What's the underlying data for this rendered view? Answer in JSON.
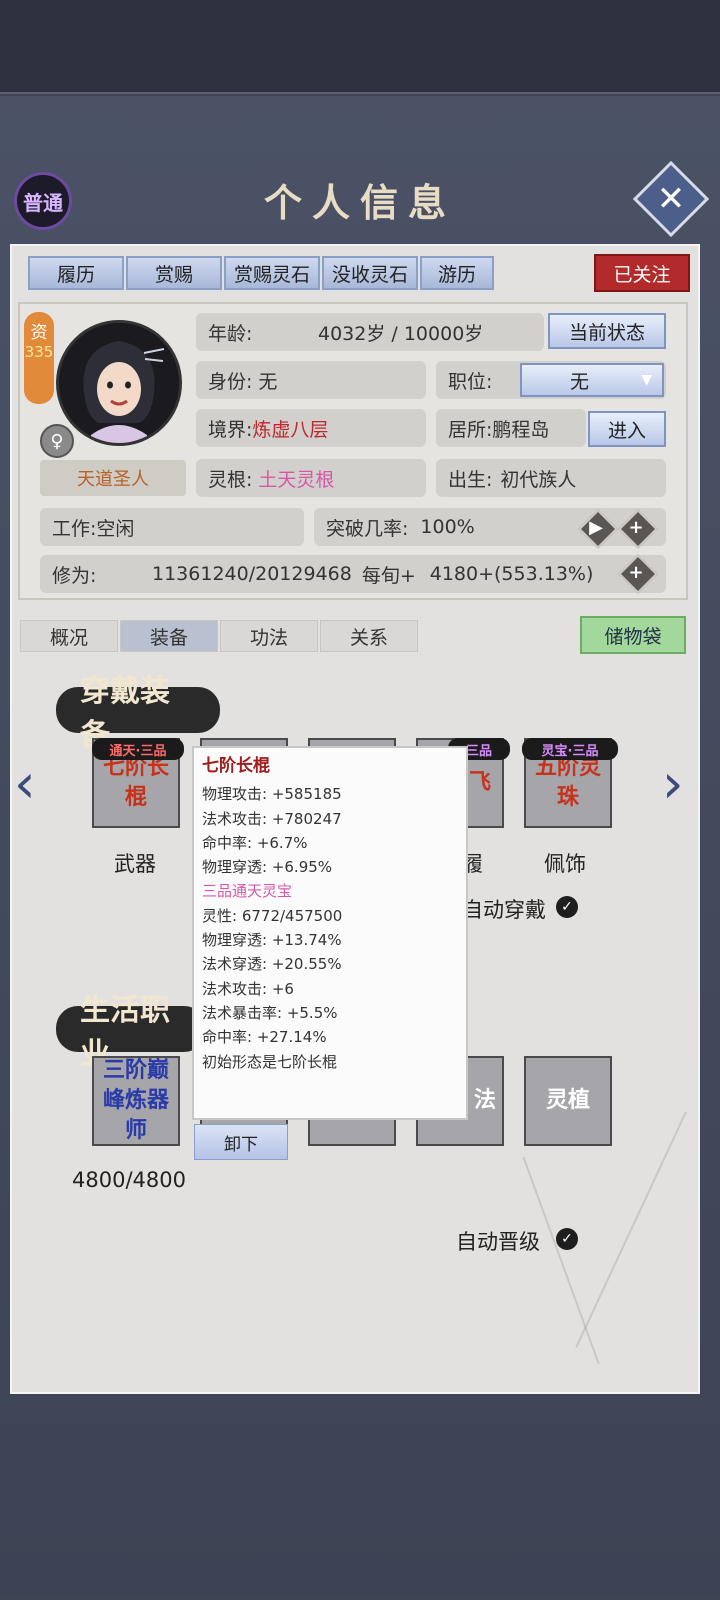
{
  "header": {
    "rank_badge": "普通",
    "title": "个人信息",
    "close_icon": "close-icon"
  },
  "top_tabs": [
    "履历",
    "赏赐",
    "赏赐灵石",
    "没收灵石",
    "游历"
  ],
  "follow_button": "已关注",
  "profile": {
    "aptitude_label": "资",
    "aptitude_value": "335",
    "gender_symbol": "♀",
    "title_tag": "天道圣人",
    "age_label": "年龄:",
    "age_value": "4032岁 / 10000岁",
    "current_state_button": "当前状态",
    "identity_label": "身份:",
    "identity_value": "无",
    "position_label": "职位:",
    "position_value": "无",
    "realm_label": "境界:",
    "realm_value": "炼虚八层",
    "residence_label": "居所:",
    "residence_value": "鹏程岛",
    "enter_button": "进入",
    "root_label": "灵根:",
    "root_value": "土天灵根",
    "birth_label": "出生:",
    "birth_value": "初代族人",
    "work_label": "工作:",
    "work_value": "空闲",
    "breakthrough_label": "突破几率:",
    "breakthrough_value": "100%",
    "cultivation_label": "修为:",
    "cultivation_value": "11361240/20129468",
    "per_turn_label": "每旬+",
    "per_turn_value": "4180+(553.13%)"
  },
  "sub_tabs": [
    "概况",
    "装备",
    "功法",
    "关系"
  ],
  "active_sub_tab": "装备",
  "storage_button": "储物袋",
  "equipment": {
    "section_title": "穿戴装备",
    "slots": [
      {
        "tag": "通天·三品",
        "name": "七阶长棍",
        "label": "武器"
      },
      {
        "tag": "",
        "name": "",
        "label": ""
      },
      {
        "tag": "",
        "name": "",
        "label": ""
      },
      {
        "tag": "三品",
        "name": "飞",
        "label": "履"
      },
      {
        "tag": "灵宝·三品",
        "name": "五阶灵珠",
        "label": "佩饰"
      }
    ],
    "auto_equip_label": "自动穿戴"
  },
  "tooltip": {
    "title": "七阶长棍",
    "lines": [
      "物理攻击: +585185",
      "法术攻击: +780247",
      "命中率: +6.7%",
      "物理穿透: +6.95%"
    ],
    "grade": "三品通天灵宝",
    "lines2": [
      "灵性: 6772/457500",
      "物理穿透: +13.74%",
      "法术穿透: +20.55%",
      "法术攻击: +6",
      "法术暴击率: +5.5%",
      "命中率: +27.14%",
      "初始形态是七阶长棍"
    ],
    "unequip_button": "卸下"
  },
  "life_jobs": {
    "section_title": "生活职业",
    "slots": [
      "三阶巅峰炼器师",
      "",
      "",
      "法",
      "灵植"
    ],
    "progress": "4800/4800",
    "auto_upgrade_label": "自动晋级"
  },
  "colors": {
    "accent_red": "#c0262c",
    "accent_pink": "#d858a8",
    "button_blue": "#b9c8e8",
    "storage_green": "#a3d89c"
  }
}
